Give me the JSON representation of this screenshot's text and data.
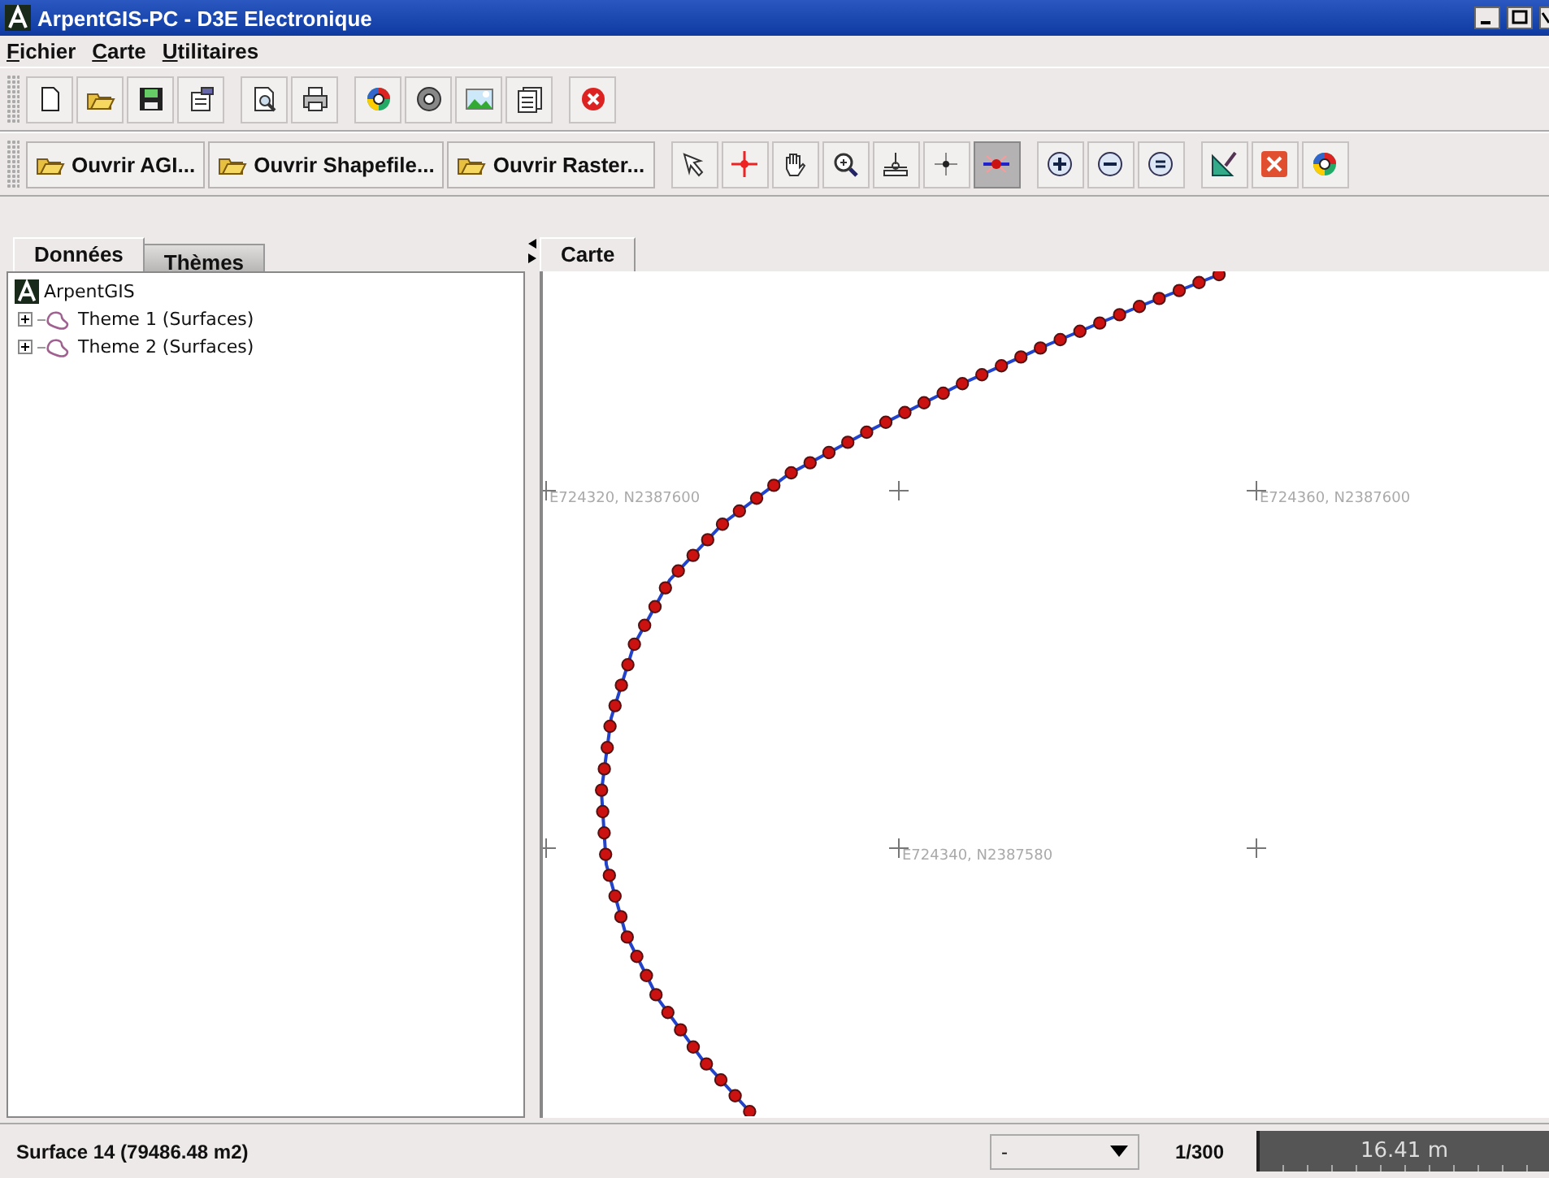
{
  "window": {
    "title": "ArpentGIS-PC - D3E Electronique"
  },
  "menu": [
    "Fichier",
    "Carte",
    "Utilitaires"
  ],
  "toolbar_1": {
    "tools": [
      {
        "kind": "new"
      },
      {
        "kind": "open"
      },
      {
        "kind": "save"
      },
      {
        "kind": "properties"
      },
      {
        "kind": "preview"
      },
      {
        "kind": "print"
      },
      {
        "kind": "colorwheel"
      },
      {
        "kind": "disc"
      },
      {
        "kind": "landscape"
      },
      {
        "kind": "document"
      },
      {
        "kind": "stop"
      }
    ]
  },
  "toolbar_2": {
    "buttons": [
      "Ouvrir AGI...",
      "Ouvrir Shapefile...",
      "Ouvrir Raster..."
    ],
    "tools": [
      {
        "kind": "arrow",
        "selected": false
      },
      {
        "kind": "cross",
        "selected": false
      },
      {
        "kind": "hand",
        "selected": false
      },
      {
        "kind": "zoom",
        "selected": false
      },
      {
        "kind": "ruler",
        "selected": false
      },
      {
        "kind": "move",
        "selected": false
      },
      {
        "kind": "vertex",
        "selected": true
      },
      {
        "kind": "plus",
        "selected": false
      },
      {
        "kind": "minus",
        "selected": false
      },
      {
        "kind": "equal",
        "selected": false
      },
      {
        "kind": "draw",
        "selected": false
      },
      {
        "kind": "xsquare",
        "selected": false
      },
      {
        "kind": "colorwheel",
        "selected": false
      }
    ]
  },
  "left_panel": {
    "tabs": [
      {
        "label": "Données",
        "selected": true
      },
      {
        "label": "Thèmes",
        "selected": false
      }
    ],
    "tree": [
      {
        "label": "ArpentGIS",
        "children": [
          {
            "label": "Theme 1 (Surfaces)",
            "expanded": false
          },
          {
            "label": "Theme 2 (Surfaces)",
            "expanded": false
          }
        ]
      }
    ]
  },
  "map_panel": {
    "tabs": [
      {
        "label": "Carte",
        "selected": true
      }
    ],
    "grid_labels": [
      "E724320, N2387600",
      "E724360, N2387600",
      "E724340, N2387580"
    ]
  },
  "status_bar": {
    "message": "Surface 14 (79486.48 m2)",
    "dropdown": "-",
    "scale": "1/300",
    "scale_bar": "16.41 m"
  }
}
